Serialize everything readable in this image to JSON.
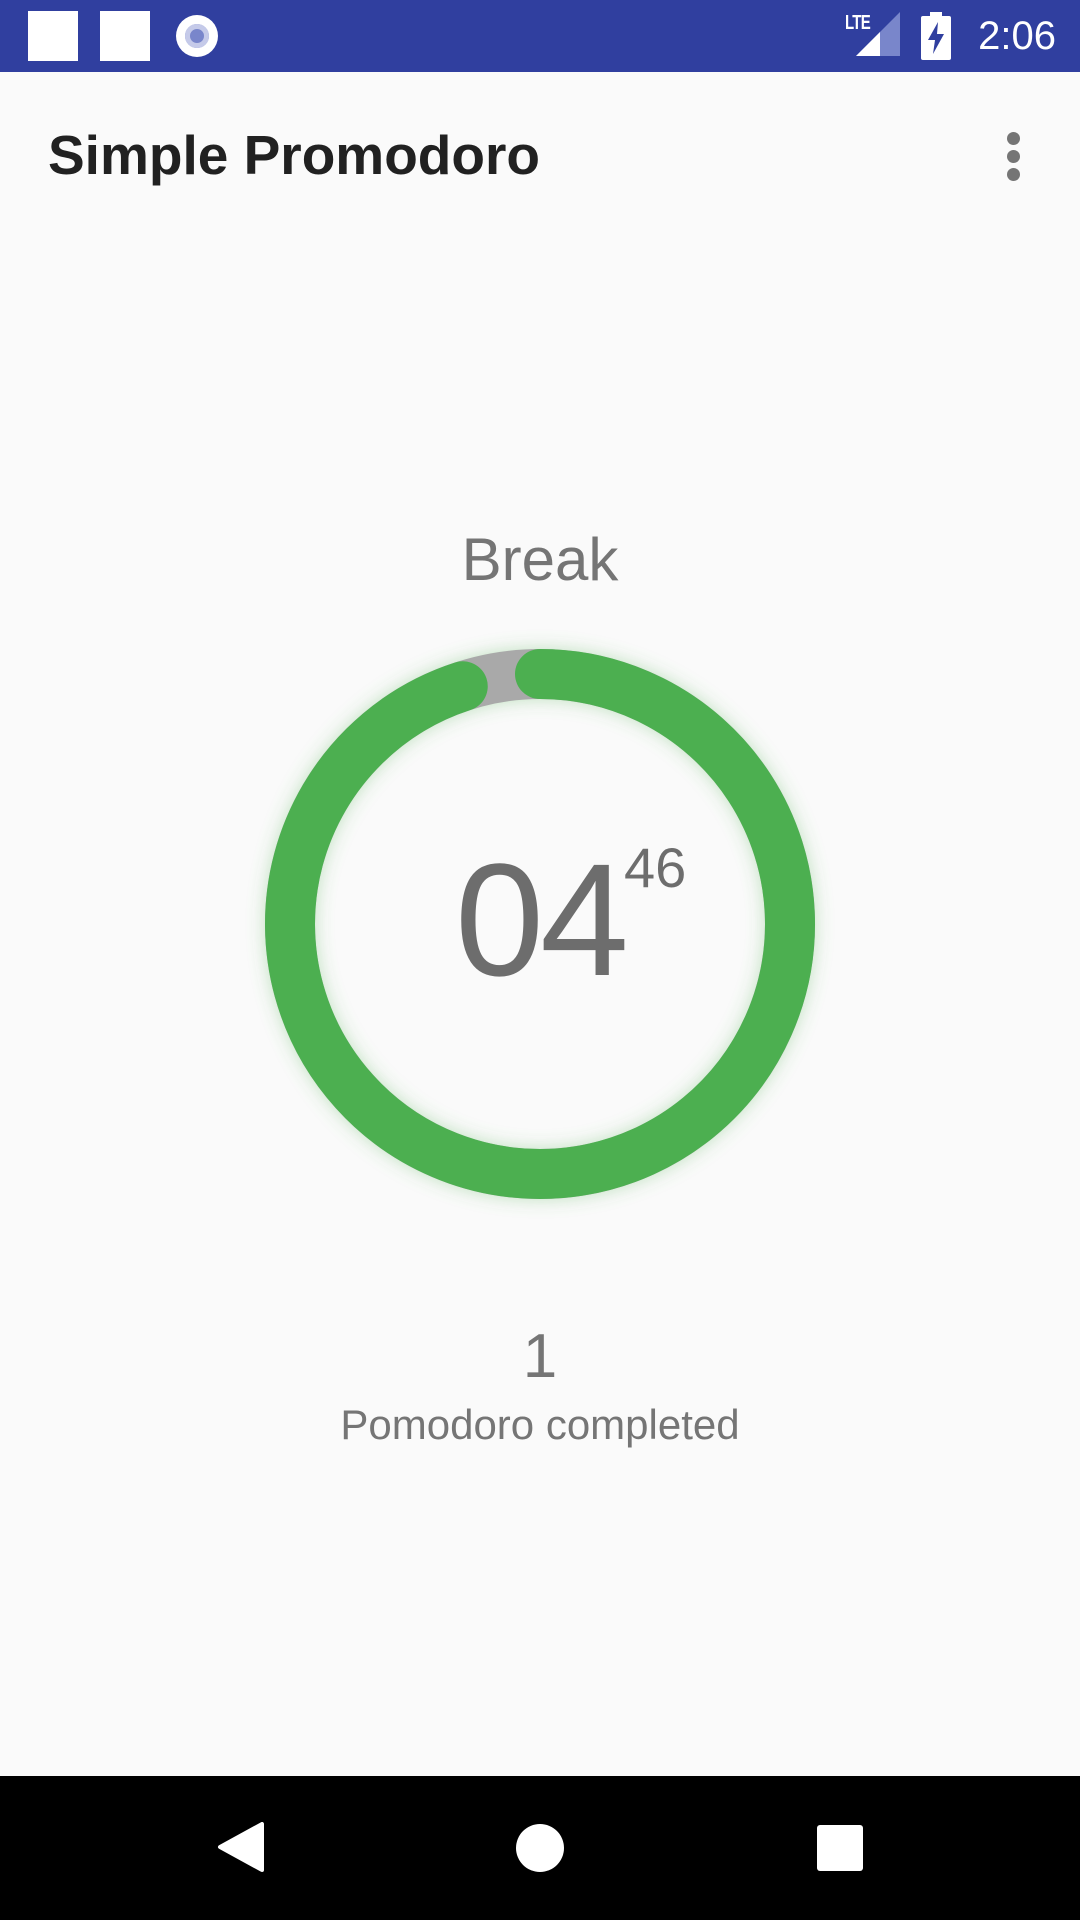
{
  "status_bar": {
    "time": "2:06",
    "network_label": "LTE",
    "icons": [
      "notification-square-icon",
      "notification-square-icon",
      "notification-circle-icon",
      "signal-icon",
      "battery-charging-icon"
    ],
    "color": "#303f9f"
  },
  "app_bar": {
    "title": "Simple Promodoro",
    "menu_icon": "more-vert-icon"
  },
  "timer": {
    "mode": "Break",
    "minutes": "04",
    "seconds": "46",
    "progress_fraction": 0.95,
    "progress_color": "#4caf50",
    "track_color": "#a9a9a9"
  },
  "stats": {
    "count": "1",
    "label": "Pomodoro completed"
  },
  "nav_bar": {
    "icons": [
      "back-icon",
      "home-icon",
      "recents-icon"
    ]
  }
}
